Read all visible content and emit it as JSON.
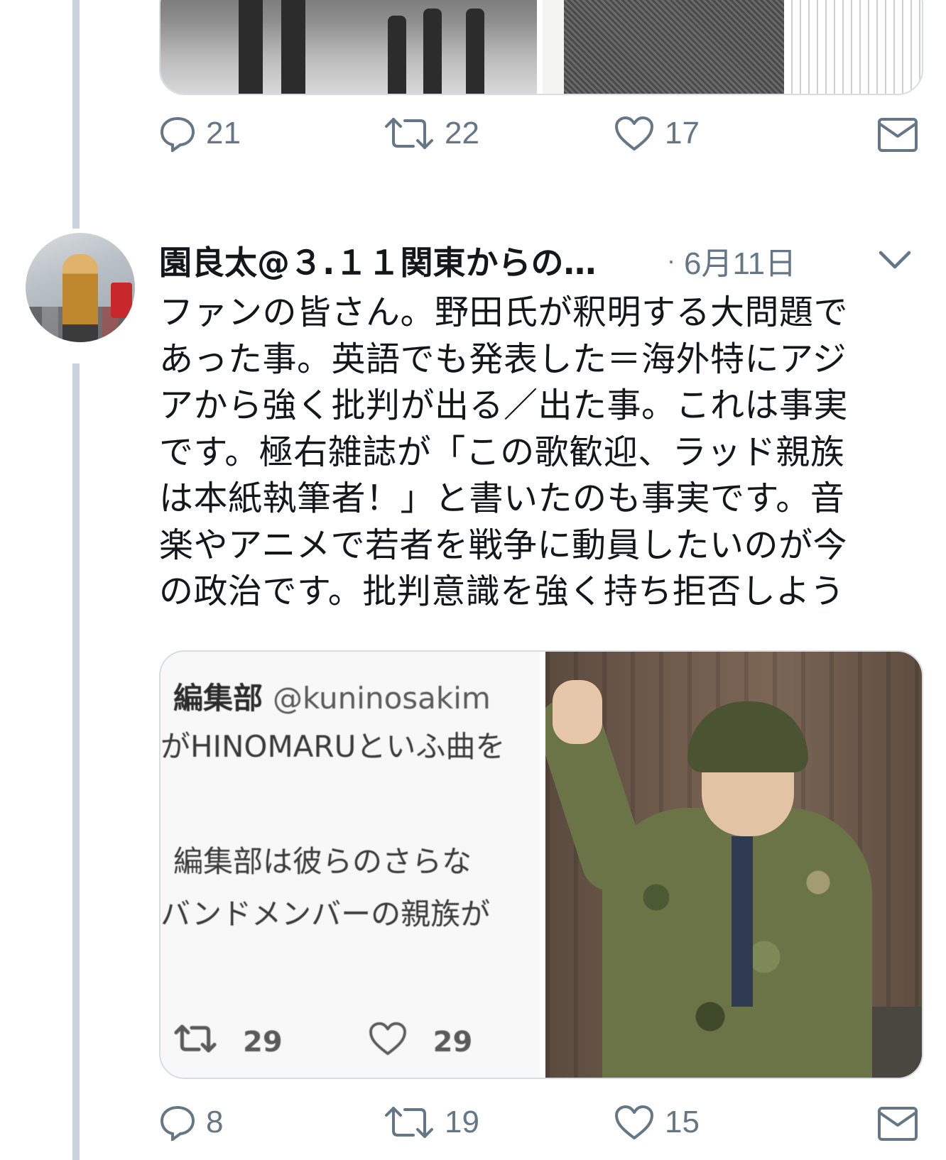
{
  "tweet1": {
    "actions": {
      "reply_count": "21",
      "retweet_count": "22",
      "like_count": "17"
    }
  },
  "tweet2": {
    "author_name": "園良太@３.１１関東からの…",
    "date_separator": "·",
    "date": "6月11日",
    "text_lines": [
      "ファンの皆さん。野田氏が釈明する大問題で",
      "あった事。英語でも発表した＝海外特にアジ",
      "アから強く批判が出る／出た事。これは事実",
      "です。極右雑誌が「この歌歓迎、ラッド親族",
      "は本紙執筆者！」と書いたのも事実です。音",
      "楽やアニメで若者を戦争に動員したいのが今",
      "の政治です。批判意識を強く持ち拒否しよう"
    ],
    "media": {
      "quote_author": "編集部",
      "quote_handle": "@kuninosakim",
      "quote_line1": "がHINOMARUといふ曲を",
      "quote_line2": "編集部は彼らのさらな",
      "quote_line3": "バンドメンバーの親族が",
      "quote_retweets": "29",
      "quote_likes": "29"
    },
    "actions": {
      "reply_count": "8",
      "retweet_count": "19",
      "like_count": "15"
    }
  },
  "icons": [
    "reply-icon",
    "retweet-icon",
    "like-icon",
    "direct-message-icon",
    "chevron-down-icon"
  ],
  "colors": {
    "text": "#14171a",
    "secondary": "#657786",
    "thread_line": "#c8d3dc",
    "border": "#d6dde3"
  }
}
